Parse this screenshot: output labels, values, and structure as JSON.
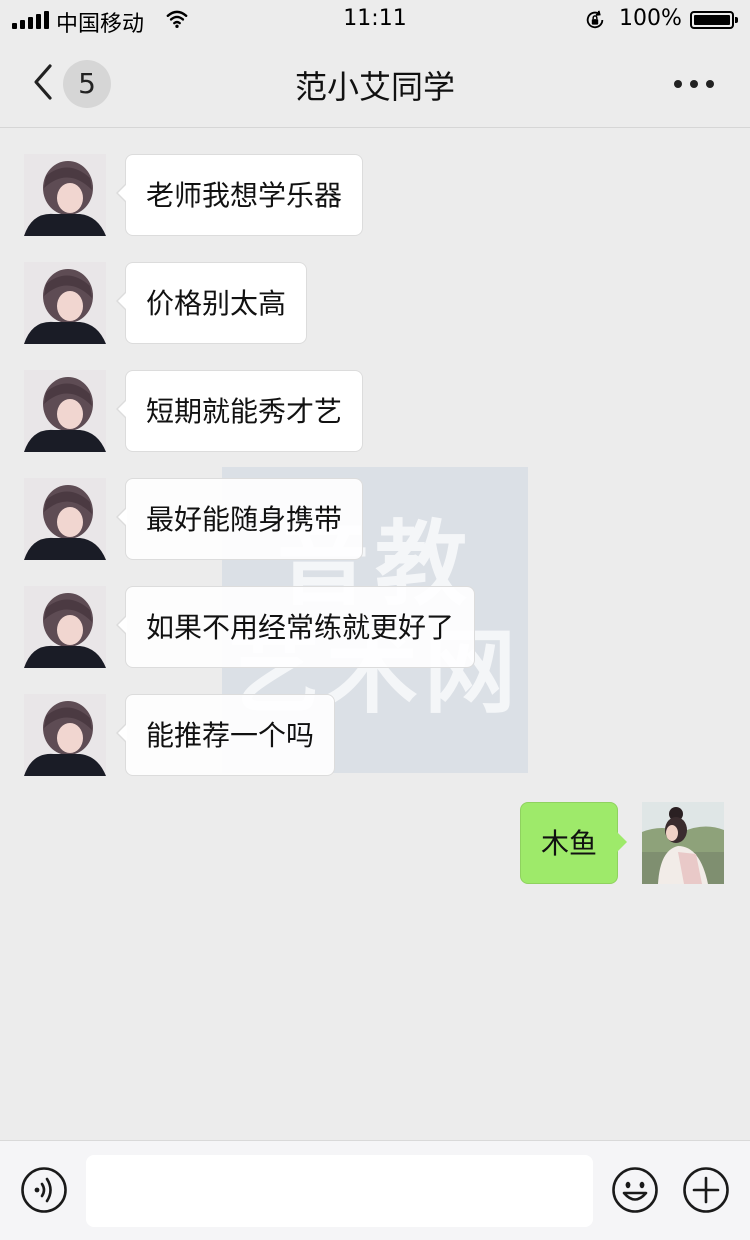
{
  "status_bar": {
    "carrier": "中国移动",
    "time": "11:11",
    "battery_percent": "100%"
  },
  "header": {
    "unread_count": "5",
    "title": "范小艾同学"
  },
  "messages": [
    {
      "sender": "other",
      "text": "老师我想学乐器"
    },
    {
      "sender": "other",
      "text": "价格别太高"
    },
    {
      "sender": "other",
      "text": "短期就能秀才艺"
    },
    {
      "sender": "other",
      "text": "最好能随身携带"
    },
    {
      "sender": "other",
      "text": "如果不用经常练就更好了"
    },
    {
      "sender": "other",
      "text": "能推荐一个吗"
    },
    {
      "sender": "me",
      "text": "木鱼"
    }
  ],
  "watermark": {
    "line1": "音教",
    "line2": "艺术网"
  },
  "input_bar": {
    "value": "",
    "placeholder": ""
  },
  "colors": {
    "background": "#ececec",
    "my_bubble": "#9eea6a",
    "other_bubble": "#ffffff"
  }
}
